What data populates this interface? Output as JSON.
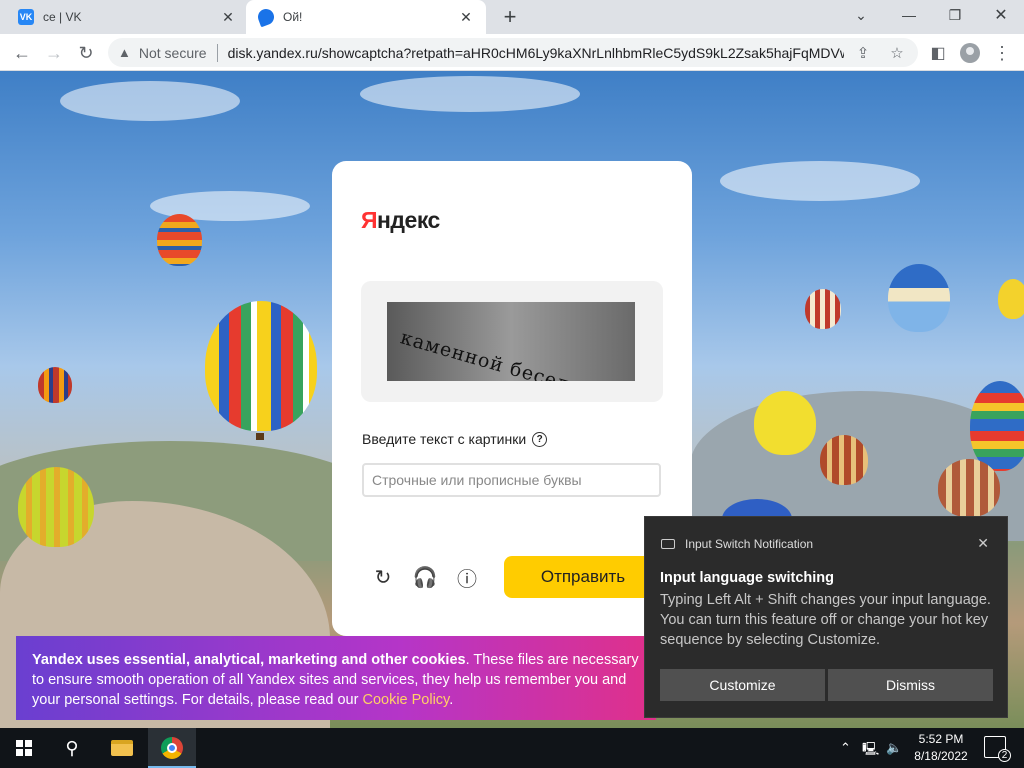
{
  "browser": {
    "tabs": [
      {
        "title": "се | VK",
        "favicon": "vk-icon",
        "active": false
      },
      {
        "title": "Ой!",
        "favicon": "yandex-disk-icon",
        "active": true
      }
    ],
    "security_label": "Not secure",
    "url": "disk.yandex.ru/showcaptcha?retpath=aHR0cHM6Ly9kaXNrLnlhbmRleC5ydS9kL2Zsak5hajFqMDVw..."
  },
  "captcha": {
    "logo_first": "Я",
    "logo_rest": "ндекс",
    "captcha_text": "каменной беседовали",
    "label": "Введите текст с картинки",
    "help_glyph": "?",
    "input_value": "",
    "input_placeholder": "Строчные или прописные буквы",
    "submit_label": "Отправить"
  },
  "cookie_banner": {
    "bold_text": "Yandex uses essential, analytical, marketing and other cookies",
    "text": ". These files are necessary to ensure smooth operation of all Yandex sites and services, they help us remember you and your personal settings. For details, please read our ",
    "link_text": "Cookie Policy",
    "end": "."
  },
  "notification": {
    "header": "Input Switch Notification",
    "title": "Input language switching",
    "body": "Typing Left Alt + Shift changes your input language. You can turn this feature off or change your hot key sequence by selecting Customize.",
    "customize_label": "Customize",
    "dismiss_label": "Dismiss"
  },
  "taskbar": {
    "time": "5:52 PM",
    "date": "8/18/2022",
    "notification_count": "2"
  },
  "colors": {
    "yandex_red": "#ff3333",
    "submit_yellow": "#ffcc00",
    "cookie_link": "#ffd166",
    "taskbar_bg": "#101418"
  }
}
